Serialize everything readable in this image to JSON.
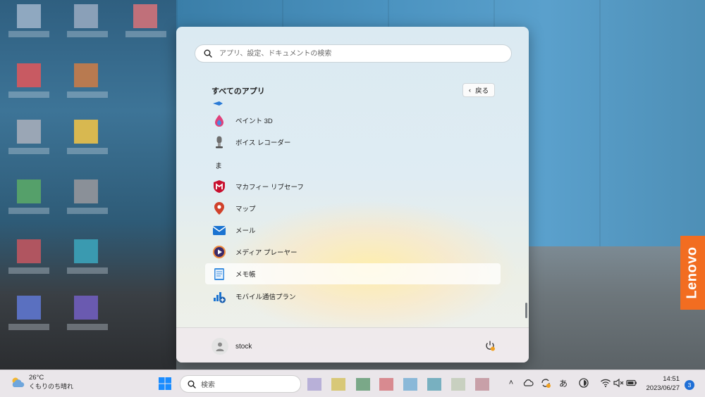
{
  "start_menu": {
    "search_placeholder": "アプリ、設定、ドキュメントの検索",
    "section_title": "すべてのアプリ",
    "back_label": "戻る",
    "letter_header": "ま",
    "apps": [
      {
        "label": "ペイント 3D",
        "icon": "paint-3d-icon"
      },
      {
        "label": "ボイス レコーダー",
        "icon": "voice-recorder-icon"
      },
      {
        "label": "マカフィー リブセーフ",
        "icon": "mcafee-icon"
      },
      {
        "label": "マップ",
        "icon": "maps-icon"
      },
      {
        "label": "メール",
        "icon": "mail-icon"
      },
      {
        "label": "メディア プレーヤー",
        "icon": "media-player-icon"
      },
      {
        "label": "メモ帳",
        "icon": "notepad-icon",
        "selected": true
      },
      {
        "label": "モバイル通信プラン",
        "icon": "mobile-plans-icon"
      }
    ],
    "user_name": "stock"
  },
  "taskbar": {
    "weather_temp": "26°C",
    "weather_condition": "くもりのち晴れ",
    "search_label": "検索",
    "ime_label": "あ",
    "time": "14:51",
    "date": "2023/06/27",
    "notification_count": "3"
  },
  "wallpaper": {
    "brand_text": "Lenovo"
  },
  "colors": {
    "accent": "#1f6fd6",
    "brand": "#f26d21"
  }
}
